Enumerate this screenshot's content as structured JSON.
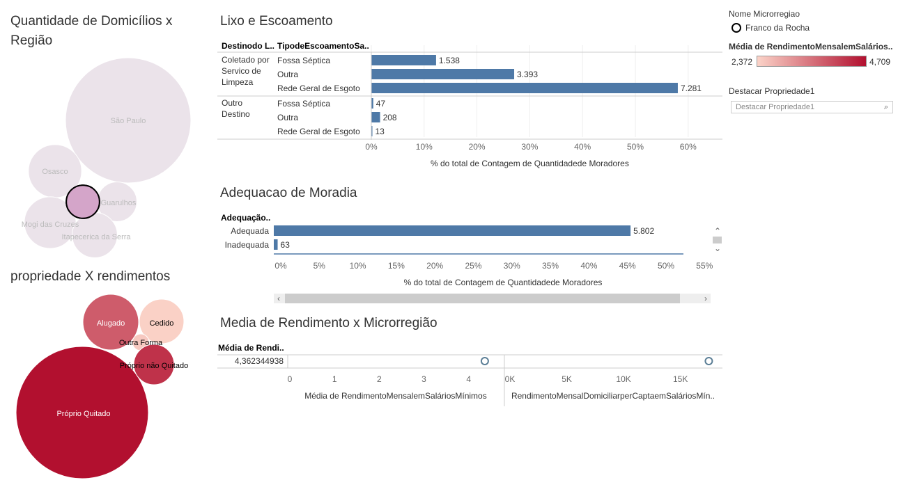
{
  "titles": {
    "domicilios": "Quantidade de Domicílios x Região",
    "propriedade": "propriedade X rendimentos",
    "lixo": "Lixo e Escoamento",
    "adequacao": "Adequacao de Moradia",
    "media": "Media de Rendimento x Microrregião"
  },
  "legend": {
    "nome_title": "Nome Microrregiao",
    "nome_item": "Franco da Rocha",
    "media_title": "Média de RendimentoMensalemSalários..",
    "media_min": "2,372",
    "media_max": "4,709",
    "color_low": "#fbd3c8",
    "color_high": "#b2102f",
    "destacar_title": "Destacar Propriedade1",
    "destacar_placeholder": "Destacar Propriedade1",
    "search_icon": "search-icon"
  },
  "colors": {
    "bar": "#4e79a7",
    "region_bubble": "#ebe3ea",
    "highlight_bubble": "#d4a5c9"
  },
  "chart_data": [
    {
      "id": "domicilios",
      "type": "bubble",
      "bubbles": [
        {
          "label": "São Paulo",
          "size": 1.0
        },
        {
          "label": "Osasco",
          "size": 0.18
        },
        {
          "label": "Guarulhos",
          "size": 0.1
        },
        {
          "label": "Mogi das Cruzes",
          "size": 0.17
        },
        {
          "label": "Itapecerica da Serra",
          "size": 0.13
        },
        {
          "label": "Franco da Rocha",
          "size": 0.07,
          "highlight": true,
          "show_label": false
        }
      ]
    },
    {
      "id": "propriedade",
      "type": "bubble",
      "bubbles": [
        {
          "label": "Próprio Quitado",
          "value": 4.71
        },
        {
          "label": "Alugado",
          "value": 3.8
        },
        {
          "label": "Cedido",
          "value": 2.4
        },
        {
          "label": "Outra Forma",
          "value": 2.5
        },
        {
          "label": "Próprio não Quitado",
          "value": 4.3
        }
      ]
    },
    {
      "id": "lixo",
      "type": "bar",
      "header_col1": "Destinodo L..",
      "header_col2": "TipodeEscoamentoSa..",
      "xlabel": "% do total de Contagem de Quantidadede Moradores",
      "xticks": [
        "0%",
        "10%",
        "20%",
        "30%",
        "40%",
        "50%",
        "60%"
      ],
      "xlim": [
        0,
        0.6
      ],
      "groups": [
        {
          "name": "Coletado por Servico de Limpeza",
          "rows": [
            {
              "label": "Fossa Séptica",
              "value_label": "1.538",
              "pct": 0.1226
            },
            {
              "label": "Outra",
              "value_label": "3.393",
              "pct": 0.2705
            },
            {
              "label": "Rede Geral de Esgoto",
              "value_label": "7.281",
              "pct": 0.5804
            }
          ]
        },
        {
          "name": "Outro Destino",
          "rows": [
            {
              "label": "Fossa Séptica",
              "value_label": "47",
              "pct": 0.0037
            },
            {
              "label": "Outra",
              "value_label": "208",
              "pct": 0.0166
            },
            {
              "label": "Rede Geral de Esgoto",
              "value_label": "13",
              "pct": 0.001
            }
          ]
        }
      ]
    },
    {
      "id": "adequacao",
      "type": "bar",
      "header": "Adequação..",
      "xlabel": "% do total de Contagem de Quantidadede Moradores",
      "xticks": [
        "0%",
        "5%",
        "10%",
        "15%",
        "20%",
        "25%",
        "30%",
        "35%",
        "40%",
        "45%",
        "50%",
        "55%"
      ],
      "xlim": [
        0,
        0.55
      ],
      "rows": [
        {
          "label": "Adequada",
          "value_label": "5.802",
          "pct": 0.4626
        },
        {
          "label": "Inadequada",
          "value_label": "63",
          "pct": 0.005
        }
      ]
    },
    {
      "id": "media",
      "type": "scatter",
      "header": "Média de Rendi..",
      "row_label": "4,362344938",
      "panel1": {
        "xlabel": "Média de RendimentoMensalemSaláriosMínimos",
        "xticks": [
          "0",
          "1",
          "2",
          "3",
          "4"
        ],
        "xlim": [
          0,
          4.8
        ],
        "value": 4.362
      },
      "panel2": {
        "xlabel": "RendimentoMensalDomiciliarperCaptaemSaláriosMín..",
        "xticks": [
          "0K",
          "5K",
          "10K",
          "15K"
        ],
        "xlim": [
          0,
          18700
        ],
        "value": 17500
      }
    }
  ]
}
